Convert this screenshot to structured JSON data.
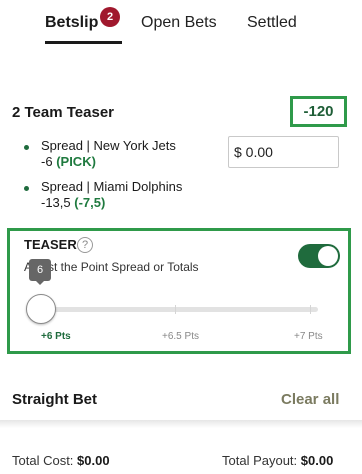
{
  "tabs": {
    "betslip": "Betslip",
    "betslip_count": "2",
    "open_bets": "Open Bets",
    "settled": "Settled"
  },
  "teaser": {
    "title": "2 Team Teaser",
    "odds": "-120",
    "stake_value": "$ 0.00"
  },
  "legs": [
    {
      "market": "Spread | New York Jets",
      "line": "-6",
      "adjusted": "(PICK)"
    },
    {
      "market": "Spread | Miami Dolphins",
      "line": "-13,5",
      "adjusted": "(-7,5)"
    }
  ],
  "teaser_panel": {
    "label": "TEASER",
    "help_icon": "?",
    "description": "Adjust the Point Spread or Totals",
    "toggle_on": true,
    "slider_value": "6",
    "options": [
      "+6 Pts",
      "+6.5 Pts",
      "+7 Pts"
    ],
    "selected_index": 0
  },
  "straight": {
    "title": "Straight Bet",
    "clear_all": "Clear all"
  },
  "footer": {
    "total_cost_label": "Total Cost:",
    "total_cost_value": "$0.00",
    "total_payout_label": "Total Payout:",
    "total_payout_value": "$0.00"
  },
  "colors": {
    "accent_green": "#1f6b3d",
    "highlight_box": "#2f9a4a",
    "badge_red": "#a0182d"
  }
}
